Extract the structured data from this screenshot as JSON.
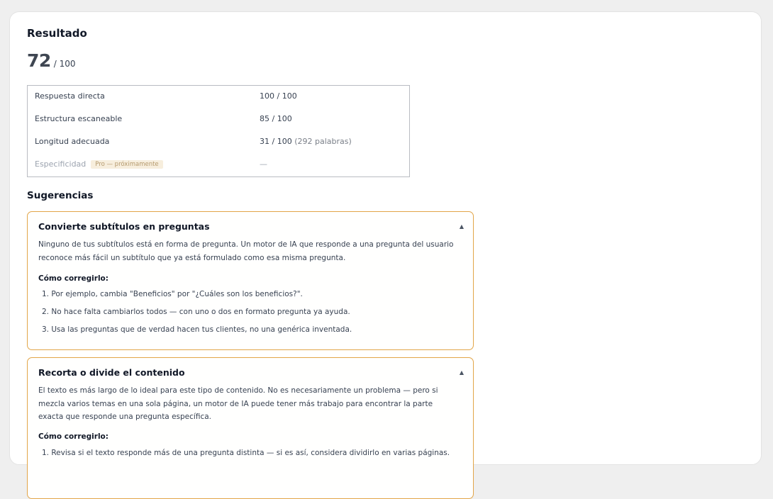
{
  "result": {
    "heading": "Resultado",
    "score": "72",
    "score_total": "/ 100"
  },
  "metrics": [
    {
      "name": "Respuesta directa",
      "value": "100 / 100",
      "extra": ""
    },
    {
      "name": "Estructura escaneable",
      "value": "85 / 100",
      "extra": ""
    },
    {
      "name": "Longitud adecuada",
      "value": "31 / 100",
      "extra": "(292 palabras)"
    },
    {
      "name": "Especificidad",
      "badge": "Pro — próximamente",
      "value": "—",
      "extra": ""
    }
  ],
  "suggestions_heading": "Sugerencias",
  "suggestions": [
    {
      "title": "Convierte subtítulos en preguntas",
      "toggle": "▲",
      "body": "Ninguno de tus subtítulos está en forma de pregunta. Un motor de IA que responde a una pregunta del usuario reconoce más fácil un subtítulo que ya está formulado como esa misma pregunta.",
      "fix_label": "Cómo corregirlo:",
      "steps": [
        "1. Por ejemplo, cambia \"Beneficios\" por \"¿Cuáles son los beneficios?\".",
        "2. No hace falta cambiarlos todos — con uno o dos en formato pregunta ya ayuda.",
        "3. Usa las preguntas que de verdad hacen tus clientes, no una genérica inventada."
      ]
    },
    {
      "title": "Recorta o divide el contenido",
      "toggle": "▲",
      "body": "El texto es más largo de lo ideal para este tipo de contenido. No es necesariamente un problema — pero si mezcla varios temas en una sola página, un motor de IA puede tener más trabajo para encontrar la parte exacta que responde una pregunta específica.",
      "fix_label": "Cómo corregirlo:",
      "steps": [
        "1. Revisa si el texto responde más de una pregunta distinta — si es así, considera dividirlo en varias páginas."
      ]
    }
  ],
  "colors": {
    "accent_border": "#e2a548",
    "badge_bg": "#f7eedd",
    "badge_text": "#b59a6e"
  }
}
